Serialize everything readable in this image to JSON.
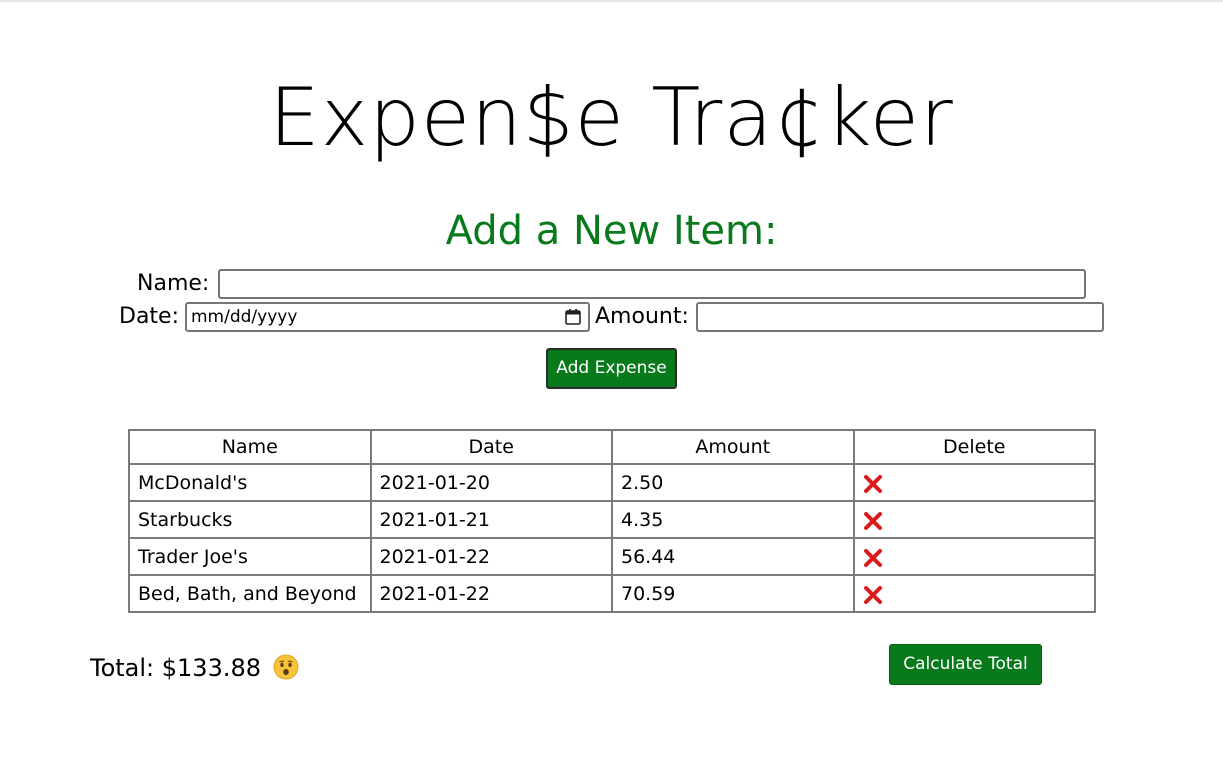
{
  "app": {
    "title": "Expen$e Tra¢ker",
    "subtitle": "Add a New Item:"
  },
  "form": {
    "name_label": "Name:",
    "name_value": "",
    "date_label": "Date:",
    "date_placeholder": "mm/dd/yyyy",
    "amount_label": "Amount:",
    "amount_value": "",
    "add_button": "Add Expense"
  },
  "table": {
    "headers": [
      "Name",
      "Date",
      "Amount",
      "Delete"
    ],
    "rows": [
      {
        "name": "McDonald's",
        "date": "2021-01-20",
        "amount": "2.50"
      },
      {
        "name": "Starbucks",
        "date": "2021-01-21",
        "amount": "4.35"
      },
      {
        "name": "Trader Joe's",
        "date": "2021-01-22",
        "amount": "56.44"
      },
      {
        "name": "Bed, Bath, and Beyond",
        "date": "2021-01-22",
        "amount": "70.59"
      }
    ]
  },
  "footer": {
    "total_text": "Total: $133.88",
    "total_emoji": "frowning-face-open-mouth-icon",
    "calc_button": "Calculate Total"
  },
  "colors": {
    "accent_green": "#087a1c",
    "delete_red": "#dd1a1a"
  },
  "icons": {
    "date_picker": "calendar-icon",
    "delete": "cross-mark-icon"
  }
}
